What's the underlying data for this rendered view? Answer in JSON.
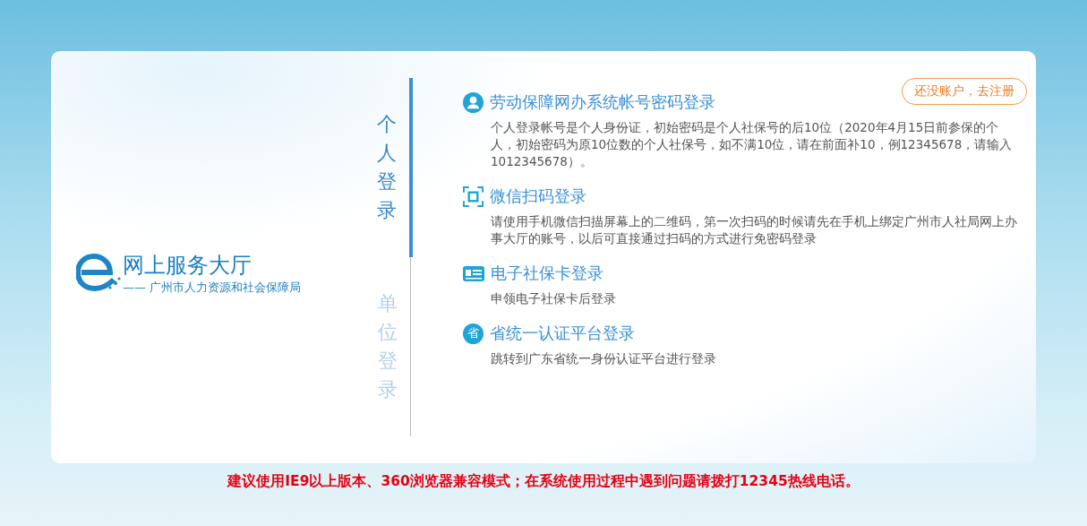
{
  "logo": {
    "title": "网上服务大厅",
    "subtitle": "—— 广州市人力资源和社会保障局"
  },
  "tabs": [
    {
      "label": "个人登录",
      "selected": true
    },
    {
      "label": "单位登录",
      "selected": false
    }
  ],
  "register_button": "还没账户，去注册",
  "methods": [
    {
      "kind": "account",
      "title": "劳动保障网办系统帐号密码登录",
      "description": "个人登录帐号是个人身份证，初始密码是个人社保号的后10位（2020年4月15日前参保的个人，初始密码为原10位数的个人社保号，如不满10位，请在前面补10，例12345678，请输入1012345678）。"
    },
    {
      "kind": "scan",
      "title": "微信扫码登录",
      "description": "请使用手机微信扫描屏幕上的二维码，第一次扫码的时候请先在手机上绑定广州市人社局网上办事大厅的账号，以后可直接通过扫码的方式进行免密码登录"
    },
    {
      "kind": "card",
      "title": "电子社保卡登录",
      "description": "申领电子社保卡后登录"
    },
    {
      "kind": "badge",
      "badge": "省",
      "title": "省统一认证平台登录",
      "description": "跳转到广东省统一身份认证平台进行登录"
    }
  ],
  "notice": "建议使用IE9以上版本、360浏览器兼容模式；在系统使用过程中遇到问题请拨打12345热线电话。"
}
